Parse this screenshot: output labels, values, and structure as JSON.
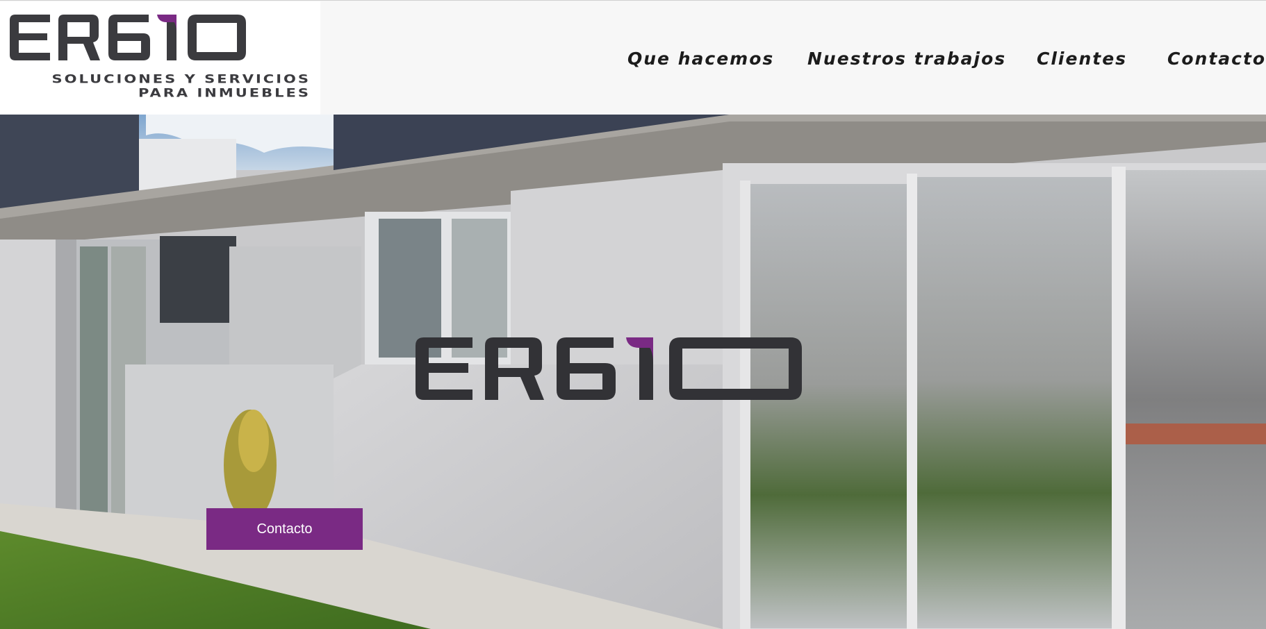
{
  "brand": {
    "logo_text": "ERGIO",
    "tagline_line1": "Soluciones y servicios",
    "tagline_line2": "para inmuebles",
    "colors": {
      "dark": "#3b3b3f",
      "accent": "#7a2a84"
    }
  },
  "nav": {
    "items": [
      {
        "label": "Que hacemos"
      },
      {
        "label": "Nuestros trabajos"
      },
      {
        "label": "Clientes"
      },
      {
        "label": "Contacto"
      }
    ]
  },
  "hero": {
    "background": "house-exterior-photo",
    "logo_text": "ERGIO",
    "cta_label": "Contacto"
  }
}
